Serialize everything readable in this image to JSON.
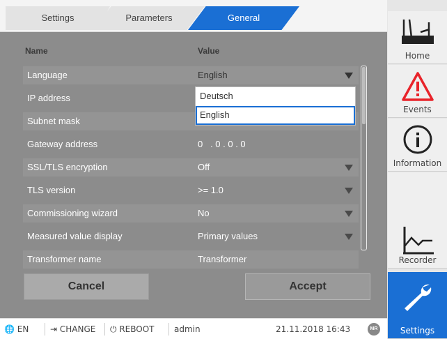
{
  "tabs": [
    {
      "label": "Settings"
    },
    {
      "label": "Parameters"
    },
    {
      "label": "General"
    }
  ],
  "table": {
    "col_name": "Name",
    "col_value": "Value",
    "rows": [
      {
        "name": "Language",
        "value": "English",
        "dropdown": true
      },
      {
        "name": "IP address",
        "value": "",
        "dropdown": false
      },
      {
        "name": "Subnet mask",
        "value": "",
        "dropdown": false
      },
      {
        "name": "Gateway address",
        "value": "0   . 0 . 0 . 0",
        "dropdown": false
      },
      {
        "name": "SSL/TLS encryption",
        "value": "Off",
        "dropdown": true
      },
      {
        "name": "TLS version",
        "value": ">= 1.0",
        "dropdown": true
      },
      {
        "name": "Commissioning wizard",
        "value": "No",
        "dropdown": true
      },
      {
        "name": "Measured value display",
        "value": "Primary values",
        "dropdown": true
      },
      {
        "name": "Transformer name",
        "value": "Transformer",
        "dropdown": false
      }
    ]
  },
  "dropdown": {
    "options": [
      "Deutsch",
      "English"
    ],
    "selected": "English"
  },
  "buttons": {
    "cancel": "Cancel",
    "accept": "Accept"
  },
  "nav": {
    "items": [
      {
        "label": "Home",
        "icon": "home-icon"
      },
      {
        "label": "Events",
        "icon": "warning-icon"
      },
      {
        "label": "Information",
        "icon": "info-icon"
      },
      {
        "label": "Recorder",
        "icon": "recorder-icon"
      },
      {
        "label": "Settings",
        "icon": "wrench-icon",
        "active": true
      }
    ]
  },
  "status": {
    "language": "EN",
    "change": "CHANGE",
    "reboot": "REBOOT",
    "user": "admin",
    "datetime": "21.11.2018 16:43",
    "logo": "MR"
  },
  "colors": {
    "accent": "#1a6fd4",
    "overlay": "#8c8c8c",
    "warning": "#e8232a"
  }
}
